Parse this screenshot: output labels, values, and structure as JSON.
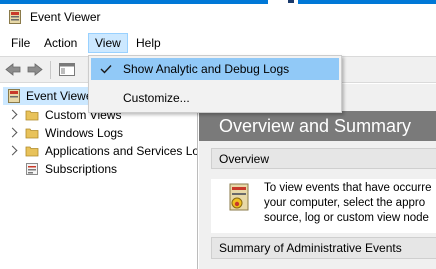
{
  "window": {
    "title": "Event Viewer"
  },
  "menubar": {
    "items": [
      "File",
      "Action",
      "View",
      "Help"
    ]
  },
  "view_menu": {
    "items": [
      {
        "label": "Show Analytic and Debug Logs",
        "checked": true
      },
      {
        "label": "Customize..."
      }
    ]
  },
  "tree": {
    "root": "Event Viewer",
    "nodes": [
      "Custom Views",
      "Windows Logs",
      "Applications and Services Lo",
      "Subscriptions"
    ]
  },
  "main": {
    "header": "Overview and Summary",
    "sections": {
      "overview": "Overview",
      "summary": "Summary of Administrative Events"
    },
    "overview_text": [
      "To view events that have occurre",
      "your computer, select the appro",
      "source, log or custom view node"
    ]
  },
  "colors": {
    "accent": "#0078d7",
    "highlight": "#91c9f7",
    "header": "#7a7a7a"
  }
}
